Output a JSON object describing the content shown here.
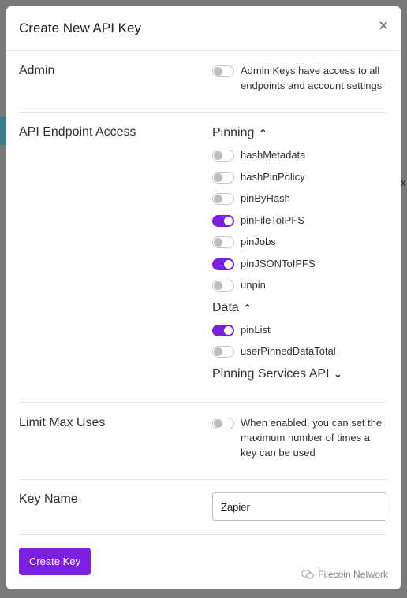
{
  "modal": {
    "title": "Create New API Key",
    "close_glyph": "×"
  },
  "admin": {
    "label": "Admin",
    "toggle_on": false,
    "description_lines": [
      "Admin Keys have access to all",
      "endpoints and account settings"
    ]
  },
  "endpoint_access": {
    "label": "API Endpoint Access",
    "groups": [
      {
        "name": "Pinning",
        "expanded": true,
        "chevron_icon": "chevron-up-icon",
        "items": [
          {
            "label": "hashMetadata",
            "on": false
          },
          {
            "label": "hashPinPolicy",
            "on": false
          },
          {
            "label": "pinByHash",
            "on": false
          },
          {
            "label": "pinFileToIPFS",
            "on": true
          },
          {
            "label": "pinJobs",
            "on": false
          },
          {
            "label": "pinJSONToIPFS",
            "on": true
          },
          {
            "label": "unpin",
            "on": false
          }
        ]
      },
      {
        "name": "Data",
        "expanded": true,
        "chevron_icon": "chevron-up-icon",
        "items": [
          {
            "label": "pinList",
            "on": true
          },
          {
            "label": "userPinnedDataTotal",
            "on": false
          }
        ]
      },
      {
        "name": "Pinning Services API",
        "expanded": false,
        "chevron_icon": "chevron-down-icon",
        "items": []
      }
    ]
  },
  "limit_max_uses": {
    "label": "Limit Max Uses",
    "toggle_on": false,
    "description_lines": [
      "When enabled, you can set the",
      "maximum number of times a",
      "key can be used"
    ]
  },
  "key_name": {
    "label": "Key Name",
    "value": "Zapier"
  },
  "create_button": {
    "label": "Create Key"
  },
  "watermark": {
    "text": "Filecoin Network"
  },
  "colors": {
    "accent": "#7b1fe0",
    "toggle_off_knob": "#bdbdbd",
    "overlay": "#7a7a7a"
  }
}
